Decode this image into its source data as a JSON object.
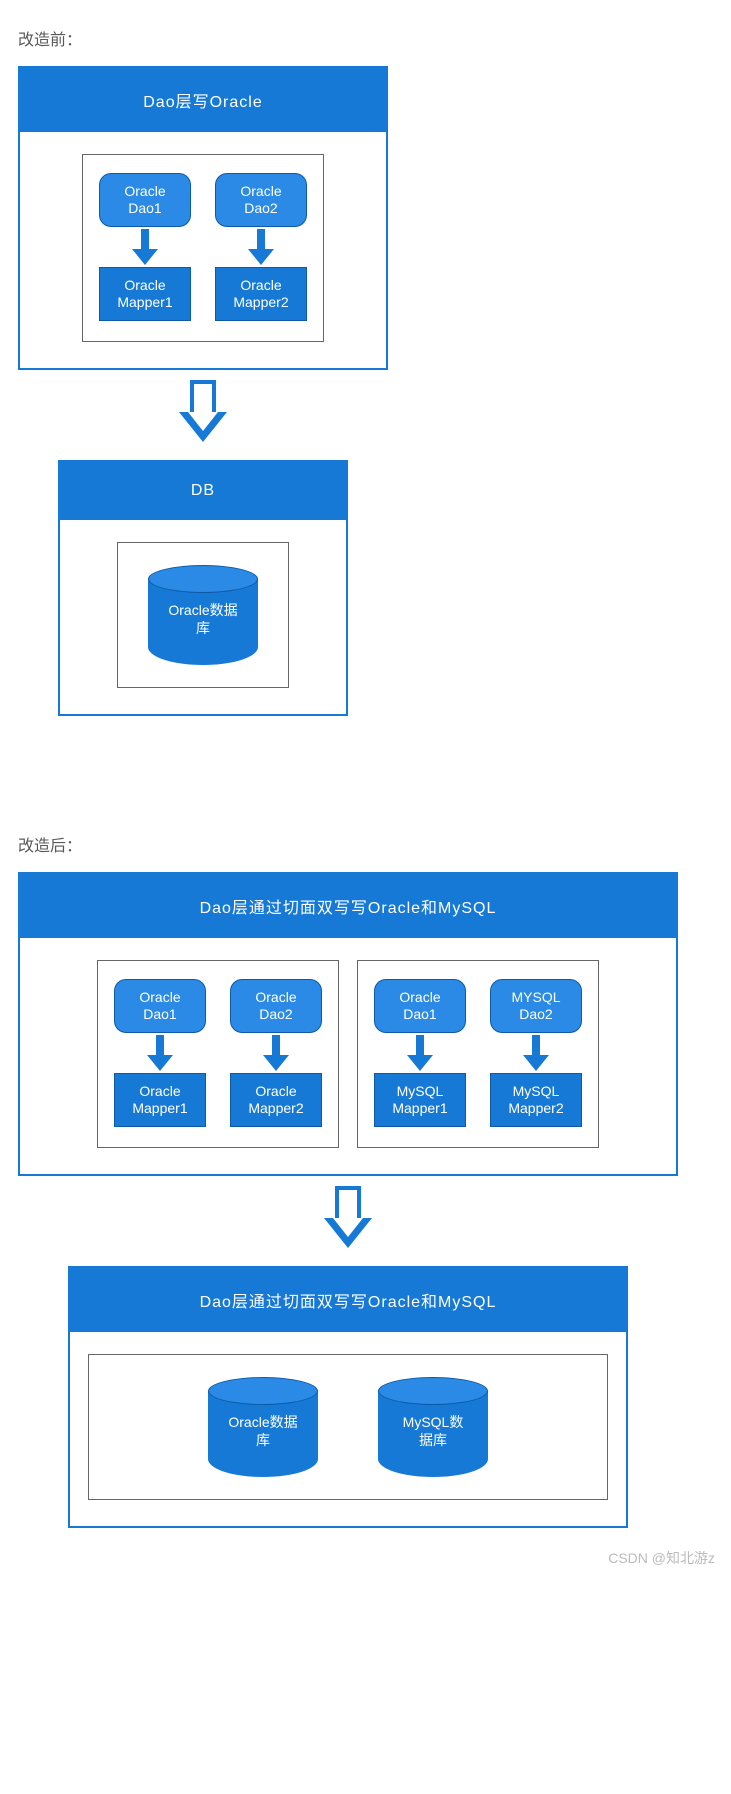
{
  "labels": {
    "before": "改造前：",
    "after": "改造后："
  },
  "before": {
    "title": "Dao层写Oracle",
    "cols": [
      {
        "dao": "Oracle\nDao1",
        "mapper": "Oracle\nMapper1"
      },
      {
        "dao": "Oracle\nDao2",
        "mapper": "Oracle\nMapper2"
      }
    ],
    "db_title": "DB",
    "db_cyl": "Oracle数据\n库"
  },
  "after": {
    "title": "Dao层通过切面双写写Oracle和MySQL",
    "left_cols": [
      {
        "dao": "Oracle\nDao1",
        "mapper": "Oracle\nMapper1"
      },
      {
        "dao": "Oracle\nDao2",
        "mapper": "Oracle\nMapper2"
      }
    ],
    "right_cols": [
      {
        "dao": "Oracle\nDao1",
        "mapper": "MySQL\nMapper1"
      },
      {
        "dao": "MYSQL\nDao2",
        "mapper": "MySQL\nMapper2"
      }
    ],
    "db_title": "Dao层通过切面双写写Oracle和MySQL",
    "db_cyls": [
      "Oracle数据\n库",
      "MySQL数\n据库"
    ]
  },
  "footer": "CSDN @知北游z"
}
